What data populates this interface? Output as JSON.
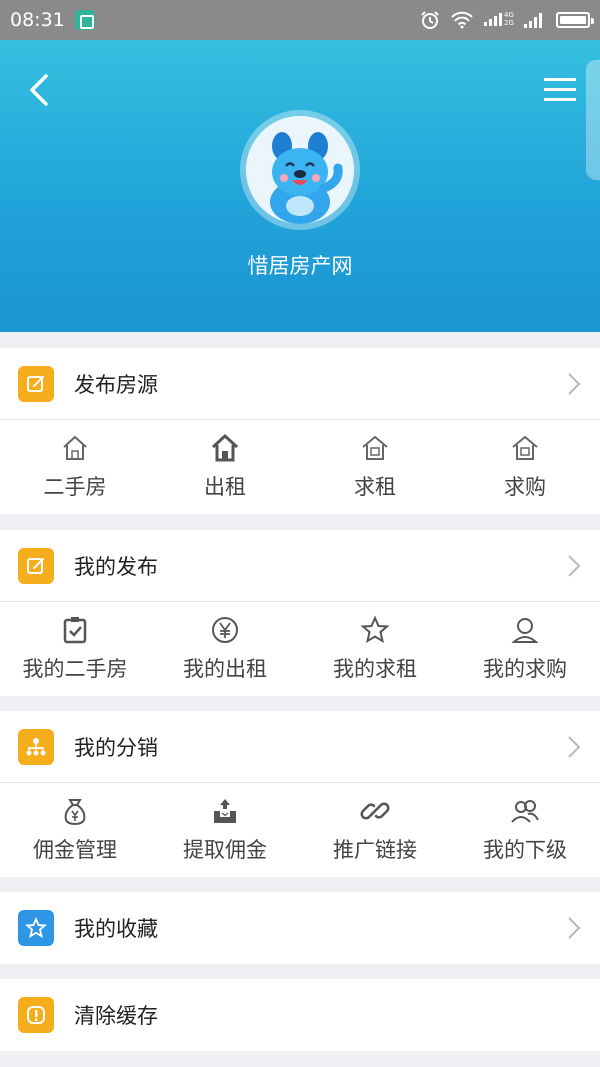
{
  "status_bar": {
    "time": "08:31",
    "icons": [
      "screenshot-app-icon",
      "alarm-icon",
      "wifi-icon",
      "signal-4g-icon",
      "signal-2g-icon",
      "battery-icon"
    ],
    "net_4g": "4G",
    "net_2g": "2G"
  },
  "header": {
    "site_name": "惜居房产网",
    "back_icon": "back-arrow-icon",
    "menu_icon": "hamburger-menu-icon",
    "avatar": "blue-cartoon-dog-avatar",
    "gradient_colors": [
      "#35c0e0",
      "#1b94d2"
    ]
  },
  "sections": {
    "publish": {
      "title": "发布房源",
      "icon": "edit-icon",
      "items": [
        {
          "label": "二手房",
          "icon": "house-outline-icon"
        },
        {
          "label": "出租",
          "icon": "house-icon"
        },
        {
          "label": "求租",
          "icon": "house-icon"
        },
        {
          "label": "求购",
          "icon": "house-icon"
        }
      ]
    },
    "my_posts": {
      "title": "我的发布",
      "icon": "edit-icon",
      "items": [
        {
          "label": "我的二手房",
          "icon": "clipboard-check-icon"
        },
        {
          "label": "我的出租",
          "icon": "yen-circle-icon"
        },
        {
          "label": "我的求租",
          "icon": "star-icon"
        },
        {
          "label": "我的求购",
          "icon": "person-icon"
        }
      ]
    },
    "distribution": {
      "title": "我的分销",
      "icon": "org-tree-icon",
      "items": [
        {
          "label": "佣金管理",
          "icon": "money-bag-icon"
        },
        {
          "label": "提取佣金",
          "icon": "withdraw-icon"
        },
        {
          "label": "推广链接",
          "icon": "link-icon"
        },
        {
          "label": "我的下级",
          "icon": "people-icon"
        }
      ]
    },
    "favorites": {
      "title": "我的收藏",
      "icon": "star-icon"
    },
    "clear_cache": {
      "title": "清除缓存",
      "icon": "alert-icon"
    }
  },
  "colors": {
    "accent_orange": "#f6ad1c",
    "accent_blue": "#2f96e6",
    "background": "#eef0f3"
  }
}
